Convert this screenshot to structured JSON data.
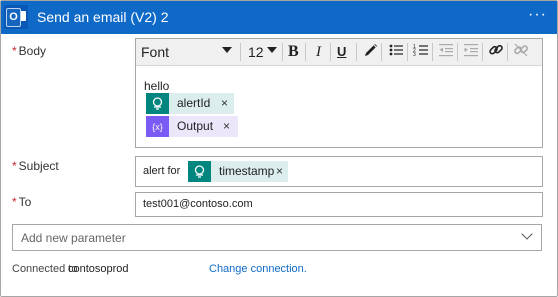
{
  "header": {
    "title": "Send an email (V2) 2",
    "more_label": "···",
    "icon": "outlook-icon",
    "color": "#0f6ac7"
  },
  "body": {
    "label": "Body",
    "toolbar": {
      "font": "Font",
      "size": "12",
      "bold": "B",
      "italic": "I",
      "underline": "U"
    },
    "text": "hello",
    "tokens": [
      {
        "label": "alertId",
        "icon": "alert-icon",
        "color": "#00857f"
      },
      {
        "label": "Output",
        "icon": "variable-icon",
        "color": "#7a5cf4"
      }
    ]
  },
  "subject": {
    "label": "Subject",
    "prefix": "alert for",
    "token": {
      "label": "timestamp",
      "icon": "alert-icon",
      "color": "#00857f"
    }
  },
  "to": {
    "label": "To",
    "value": "test001@contoso.com"
  },
  "add_parameter": {
    "placeholder": "Add new parameter"
  },
  "footer": {
    "connected_label": "Connected to",
    "connection": "contosoprod",
    "change_link": "Change connection."
  },
  "close_glyph": "×",
  "required_marker": "*"
}
